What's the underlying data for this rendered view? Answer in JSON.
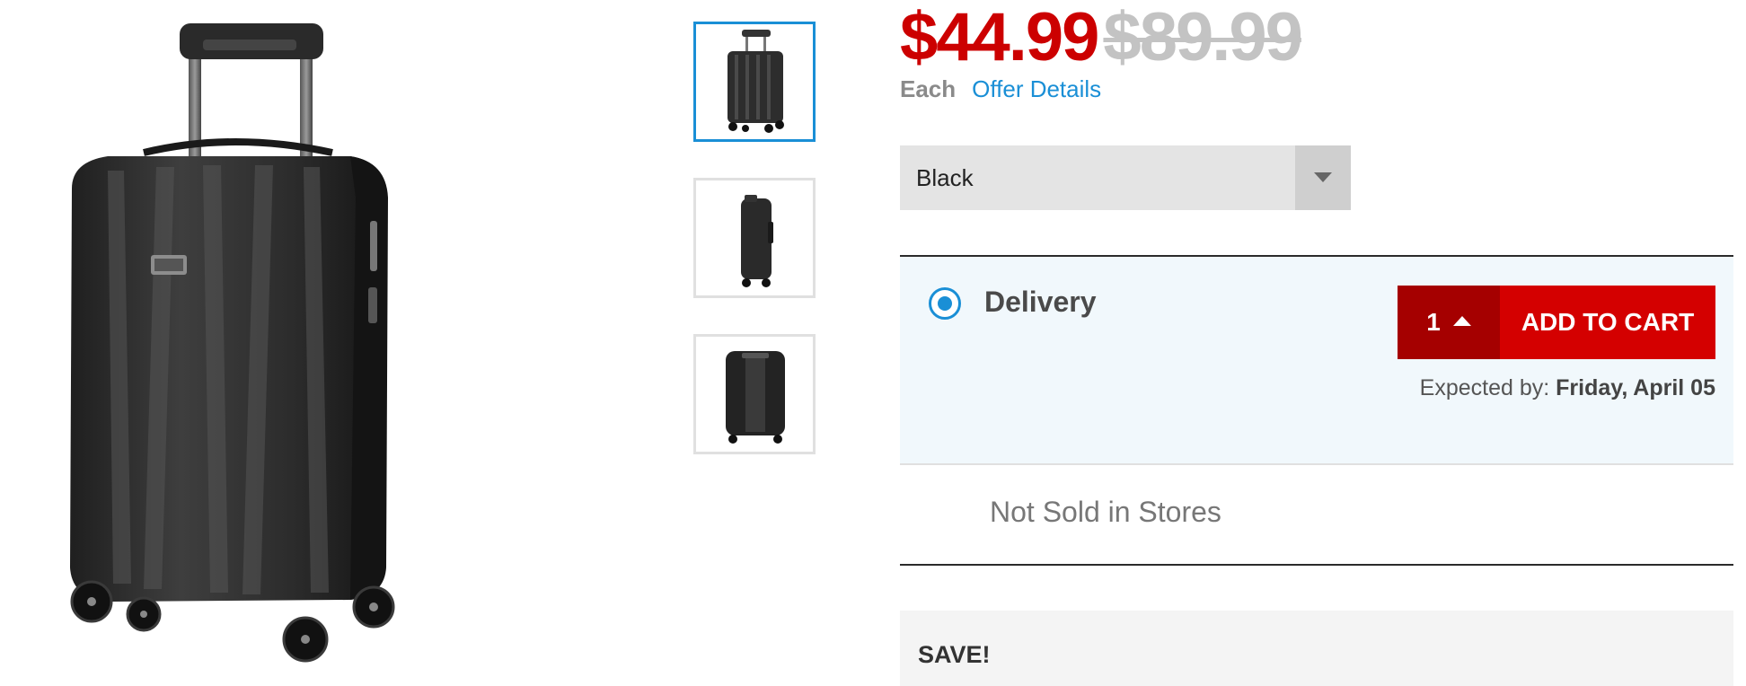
{
  "product": {
    "image_alt": "black hardside spinner carry-on suitcase",
    "thumbnails": [
      {
        "view": "front",
        "selected": true
      },
      {
        "view": "side",
        "selected": false
      },
      {
        "view": "back",
        "selected": false
      }
    ]
  },
  "pricing": {
    "sale_price": "$44.99",
    "original_price": "$89.99",
    "unit_label": "Each",
    "offer_link": "Offer Details",
    "sale_color": "#cc0000",
    "original_color": "#c3c3c3"
  },
  "color_select": {
    "value": "Black",
    "icon": "chevron-down-icon"
  },
  "fulfillment": {
    "delivery": {
      "label": "Delivery",
      "selected": true,
      "quantity": "1",
      "add_to_cart_label": "ADD TO CART",
      "expected_label": "Expected by:",
      "expected_date": "Friday, April 05"
    },
    "store": {
      "label": "Not Sold in Stores"
    }
  },
  "promo": {
    "title": "SAVE!"
  },
  "colors": {
    "accent_red": "#d40000",
    "dark_red": "#a50000",
    "link_blue": "#1a8fd6",
    "panel_bg": "#f1f8fc"
  }
}
